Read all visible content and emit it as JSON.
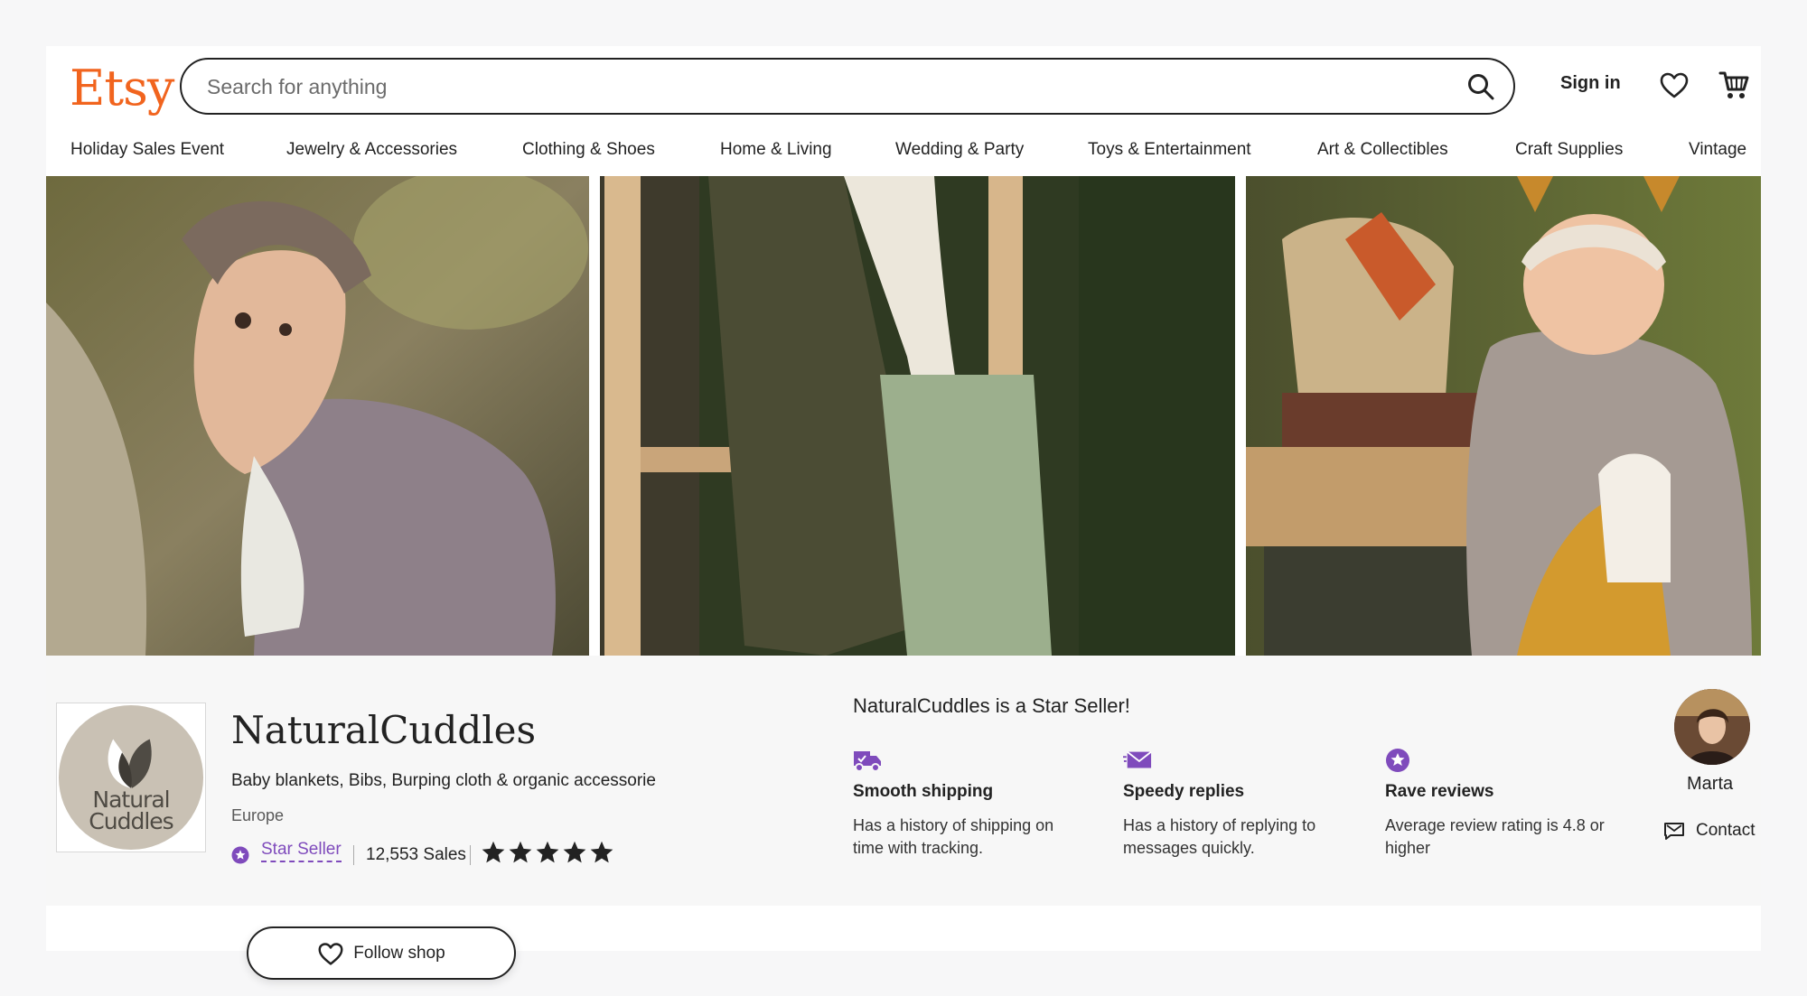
{
  "header": {
    "logo": "Etsy",
    "search_placeholder": "Search for anything",
    "sign_in": "Sign in",
    "icons": {
      "search": "search-icon",
      "favorites": "heart-icon",
      "cart": "cart-icon"
    }
  },
  "categories": [
    "Holiday Sales Event",
    "Jewelry & Accessories",
    "Clothing & Shoes",
    "Home & Living",
    "Wedding & Party",
    "Toys & Entertainment",
    "Art & Collectibles",
    "Craft Supplies",
    "Vintage"
  ],
  "shop": {
    "logo_text_line1": "Natural",
    "logo_text_line2": "Cuddles",
    "name": "NaturalCuddles",
    "tagline": "Baby blankets, Bibs, Burping cloth & organic accessorie",
    "location": "Europe",
    "star_seller_label": "Star Seller",
    "sales": "12,553 Sales",
    "rating_stars": 5,
    "follow_label": "Follow shop"
  },
  "star_seller": {
    "heading": "NaturalCuddles is a Star Seller!",
    "perks": [
      {
        "title": "Smooth shipping",
        "desc": "Has a history of shipping on time with tracking.",
        "icon": "truck-icon"
      },
      {
        "title": "Speedy replies",
        "desc": "Has a history of replying to messages quickly.",
        "icon": "envelope-icon"
      },
      {
        "title": "Rave reviews",
        "desc": "Average review rating is 4.8 or higher",
        "icon": "star-badge-icon"
      }
    ]
  },
  "owner": {
    "name": "Marta",
    "contact_label": "Contact"
  },
  "colors": {
    "brand": "#f1641e",
    "star_seller_purple": "#7f4bbc",
    "text": "#222222",
    "panel_bg": "#f7f7f7"
  }
}
